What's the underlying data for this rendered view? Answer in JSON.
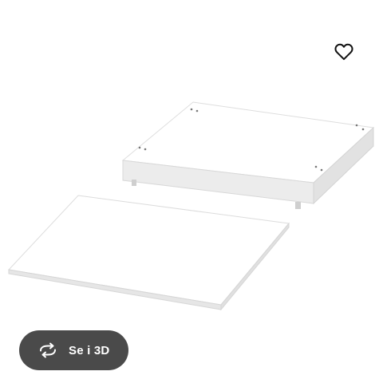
{
  "favorite": {
    "icon": "heart-outline-icon"
  },
  "view3d": {
    "label": "Se i 3D",
    "icon": "rotate-3d-icon"
  },
  "colors": {
    "button_background": "#4a4a4a",
    "icon_stroke": "#111111",
    "panel_white": "#ffffff",
    "panel_shadow": "#d7d7d7"
  }
}
